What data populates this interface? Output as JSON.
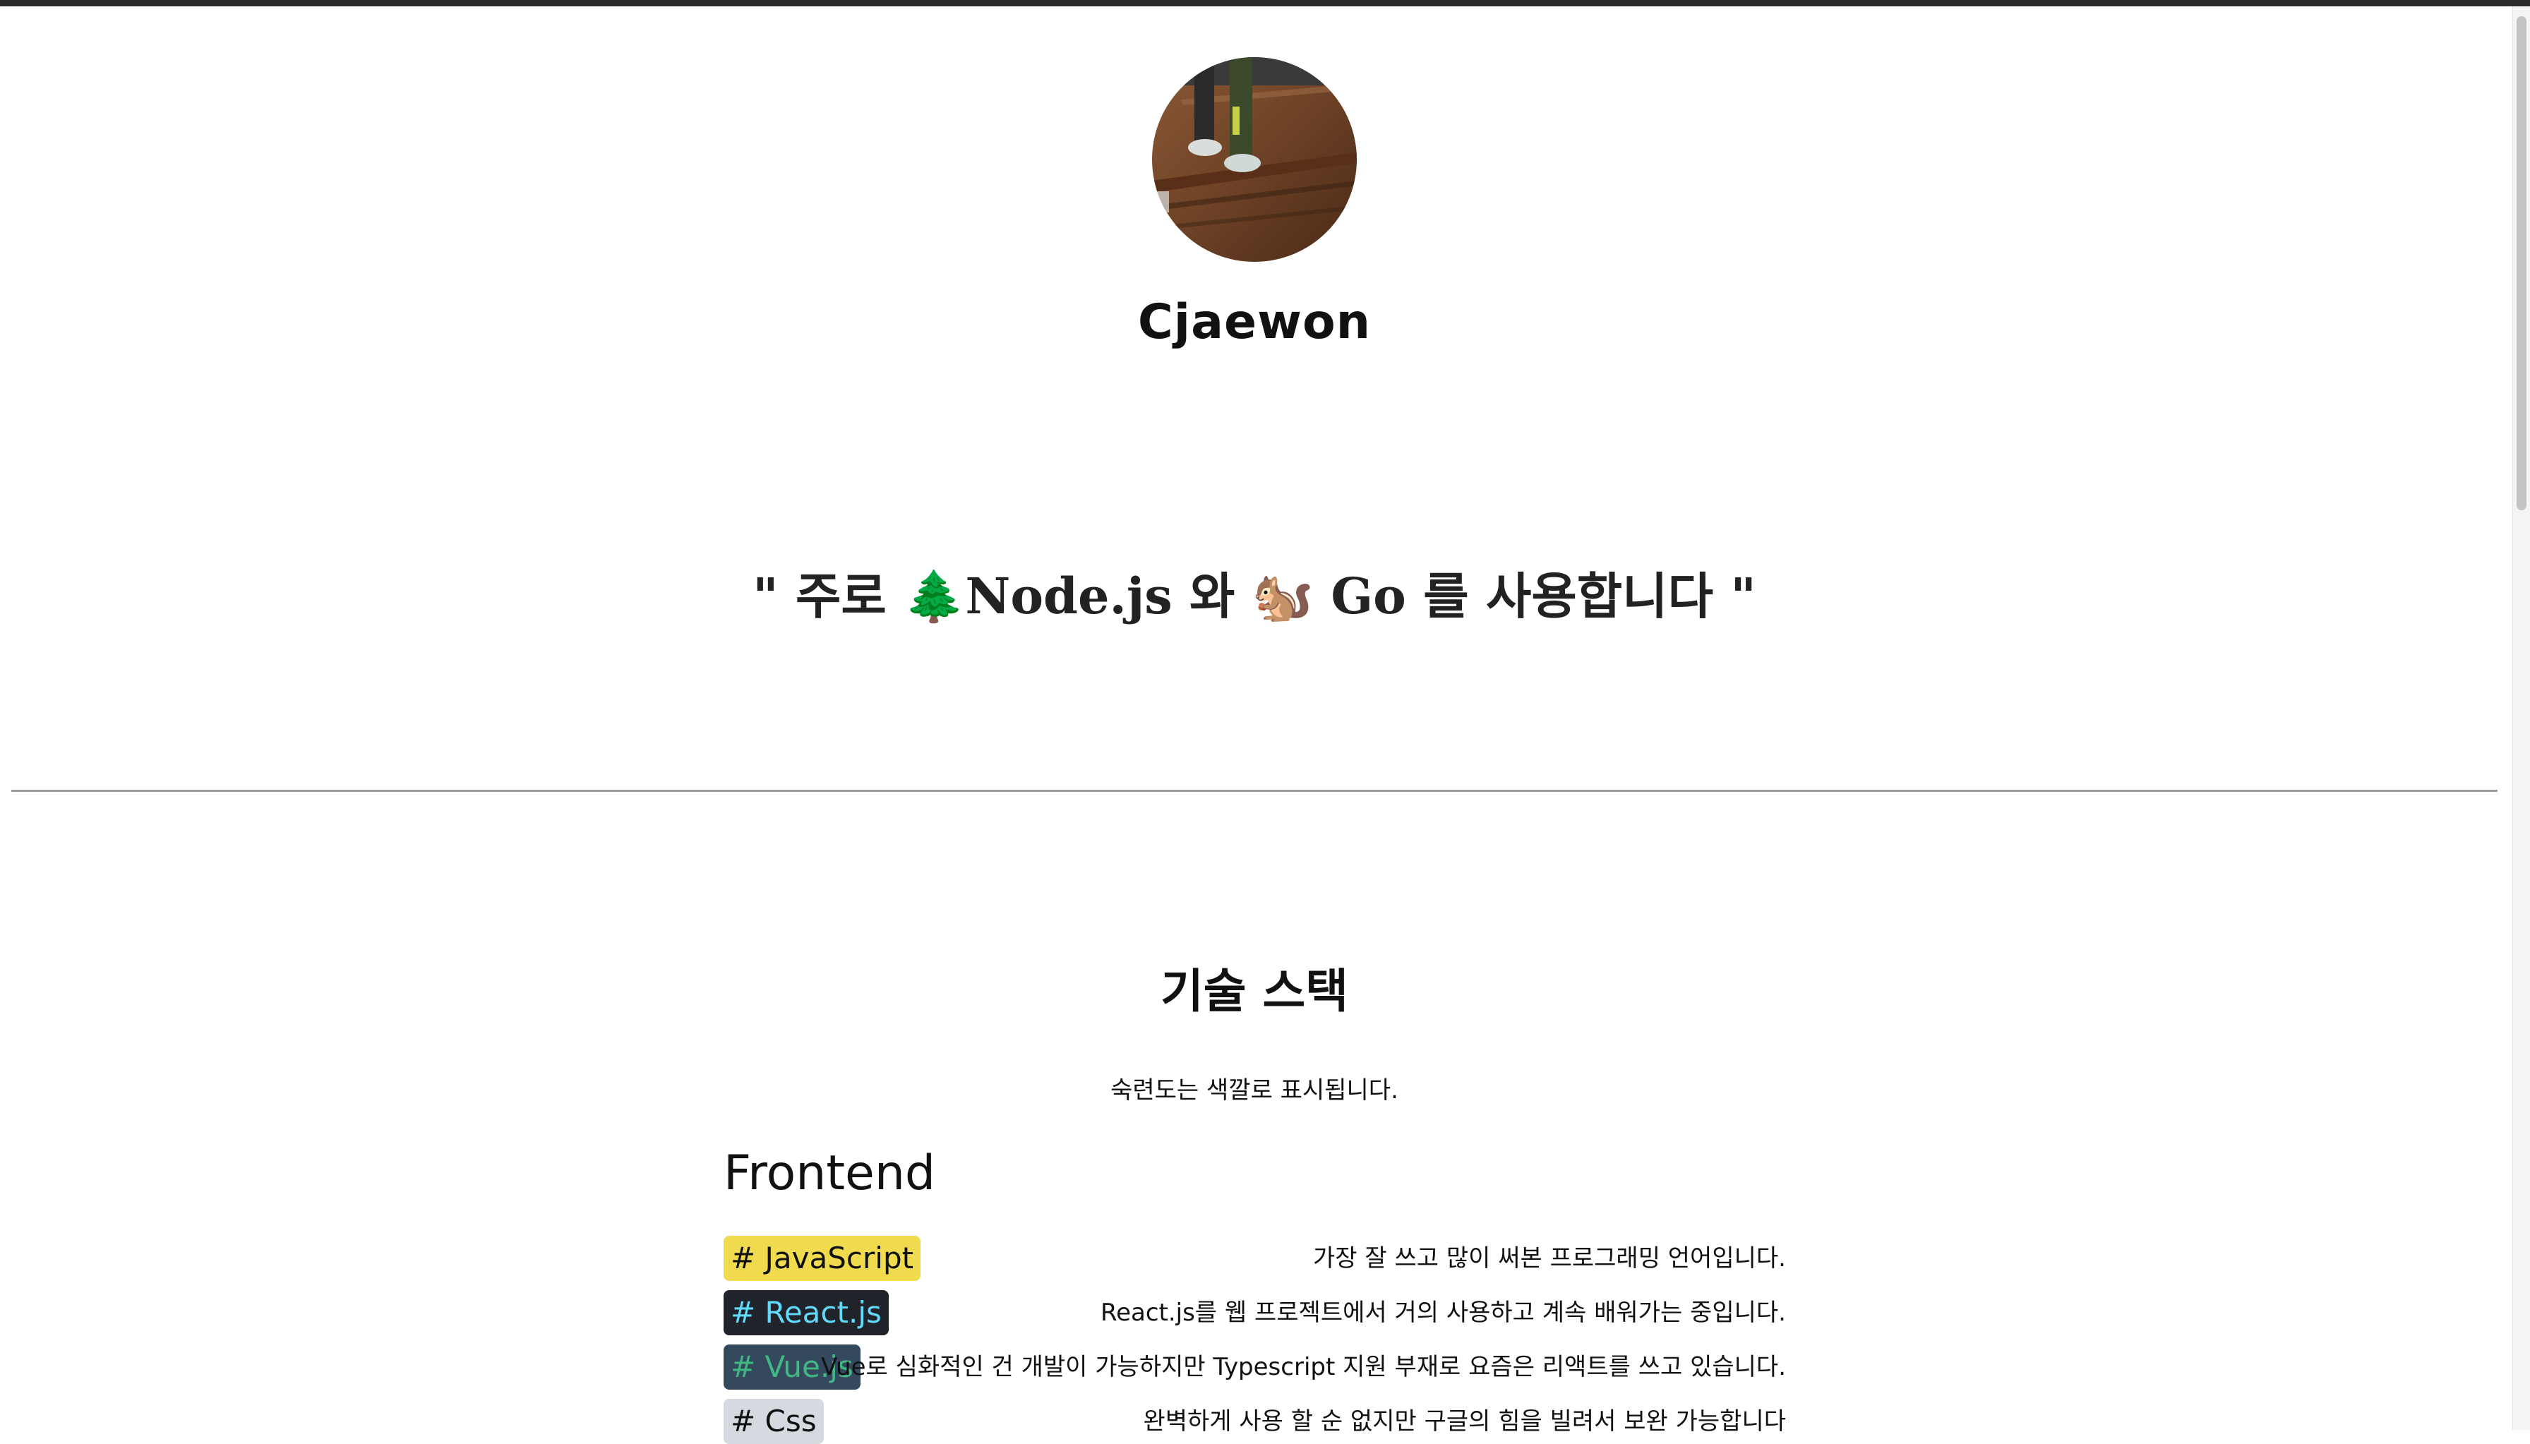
{
  "profile": {
    "name": "Cjaewon"
  },
  "motto": {
    "open_quote": "\"",
    "text_1": "주로",
    "emoji_1": "🌲",
    "lang_1": "Node.js",
    "text_2": "와",
    "emoji_2": "🐿️",
    "lang_2": "Go",
    "text_3": "를 사용합니다",
    "close_quote": "\""
  },
  "stack": {
    "title": "기술 스택",
    "subtitle": "숙련도는 색깔로 표시됩니다.",
    "groups": [
      {
        "name": "Frontend",
        "skills": [
          {
            "tag": "# JavaScript",
            "description": "가장 잘 쓰고 많이 써본 프로그래밍 언어입니다.",
            "tag_bg": "#f0db4f",
            "tag_fg": "#111111"
          },
          {
            "tag": "# React.js",
            "description": "React.js를 웹 프로젝트에서 거의 사용하고 계속 배워가는 중입니다.",
            "tag_bg": "#20232a",
            "tag_fg": "#61dafb"
          },
          {
            "tag": "# Vue.js",
            "description": "Vue로 심화적인 건 개발이 가능하지만 Typescript 지원 부재로 요즘은 리액트를 쓰고 있습니다.",
            "tag_bg": "#35495e",
            "tag_fg": "#41b883"
          },
          {
            "tag": "# Css",
            "description": "완벽하게 사용 할 순 없지만 구글의 힘을 빌려서 보완 가능합니다",
            "tag_bg": "#d5d9e0",
            "tag_fg": "#111111"
          }
        ]
      }
    ]
  },
  "colors": {
    "topbar": "#2b2b2b",
    "divider": "#9a9a9a"
  }
}
